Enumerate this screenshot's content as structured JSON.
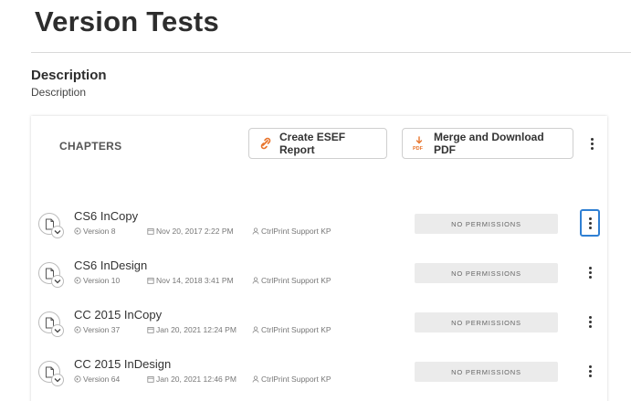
{
  "page": {
    "title": "Version Tests",
    "description_heading": "Description",
    "description_text": "Description"
  },
  "panel": {
    "section_label": "CHAPTERS",
    "buttons": {
      "create_esef": "Create ESEF Report",
      "merge_pdf": "Merge and Download PDF"
    },
    "icons": {
      "esef": "esef-link-icon",
      "merge": "pdf-download-icon",
      "more": "more-vertical-icon",
      "document": "document-icon",
      "expand": "chevron-down-icon",
      "version": "version-icon",
      "calendar": "calendar-icon",
      "user": "user-icon"
    },
    "accent_color": "#e8742c",
    "focus_color": "#2f7fd3"
  },
  "chapters": [
    {
      "title": "CS6 InCopy",
      "version": "Version 8",
      "date": "Nov 20, 2017 2:22 PM",
      "user": "CtrlPrint Support KP",
      "permission": "NO PERMISSIONS",
      "menu_focused": true
    },
    {
      "title": "CS6 InDesign",
      "version": "Version 10",
      "date": "Nov 14, 2018 3:41 PM",
      "user": "CtrlPrint Support KP",
      "permission": "NO PERMISSIONS",
      "menu_focused": false
    },
    {
      "title": "CC 2015 InCopy",
      "version": "Version 37",
      "date": "Jan 20, 2021 12:24 PM",
      "user": "CtrlPrint Support KP",
      "permission": "NO PERMISSIONS",
      "menu_focused": false
    },
    {
      "title": "CC 2015 InDesign",
      "version": "Version 64",
      "date": "Jan 20, 2021 12:46 PM",
      "user": "CtrlPrint Support KP",
      "permission": "NO PERMISSIONS",
      "menu_focused": false
    }
  ]
}
